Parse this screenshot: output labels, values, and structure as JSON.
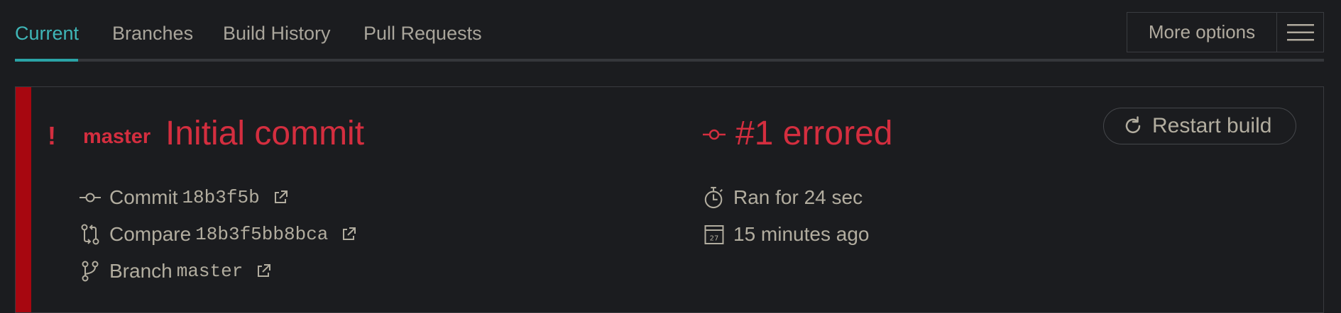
{
  "tabs": {
    "current": "Current",
    "branches": "Branches",
    "build_history": "Build History",
    "pull_requests": "Pull Requests"
  },
  "toolbar": {
    "more_options": "More options",
    "menu_icon": "hamburger-menu-icon"
  },
  "build": {
    "state_icon": "exclamation-icon",
    "branch": "master",
    "commit_message": "Initial commit",
    "status_icon": "commit-node-icon",
    "status": "#1 errored",
    "restart_label": "Restart build",
    "restart_icon": "restart-arrow-icon",
    "commit": {
      "label": "Commit",
      "value": "18b3f5b",
      "icon": "commit-icon"
    },
    "compare": {
      "label": "Compare",
      "value": "18b3f5bb8bca",
      "icon": "compare-icon"
    },
    "branch_row": {
      "label": "Branch",
      "value": "master",
      "icon": "branch-icon"
    },
    "duration": {
      "text": "Ran for 24 sec",
      "icon": "stopwatch-icon"
    },
    "finished": {
      "text": "15 minutes ago",
      "icon": "calendar-icon",
      "calendar_day": "27"
    },
    "external_link_icon": "external-link-icon"
  },
  "colors": {
    "accent": "#3fb6b7",
    "error": "#d42e3f",
    "error_stripe": "#a70710",
    "background": "#1b1c1f"
  }
}
